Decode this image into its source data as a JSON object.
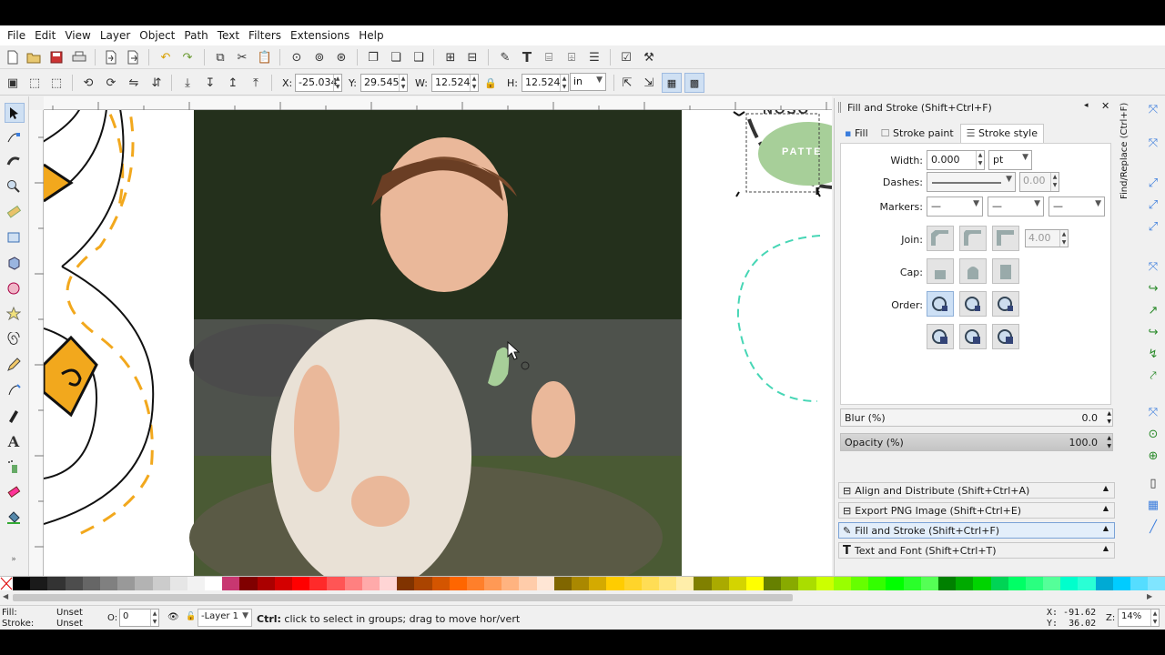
{
  "menubar": {
    "items": [
      "File",
      "Edit",
      "View",
      "Layer",
      "Object",
      "Path",
      "Text",
      "Filters",
      "Extensions",
      "Help"
    ]
  },
  "controls": {
    "x_label": "X:",
    "x_value": "-25.034",
    "y_label": "Y:",
    "y_value": "29.545",
    "w_label": "W:",
    "w_value": "12.524",
    "h_label": "H:",
    "h_value": "12.524",
    "unit": "in"
  },
  "canvas": {
    "pattern_text": "PATTE",
    "top_text": "NOSO"
  },
  "dock": {
    "title": "Fill and Stroke (Shift+Ctrl+F)",
    "tabs": [
      "Fill",
      "Stroke paint",
      "Stroke style"
    ],
    "width_label": "Width:",
    "width_value": "0.000",
    "width_unit": "pt",
    "dashes_label": "Dashes:",
    "dashes_value": "0.00",
    "markers_label": "Markers:",
    "marker_value": "—",
    "join_label": "Join:",
    "miter_value": "4.00",
    "cap_label": "Cap:",
    "order_label": "Order:",
    "blur_label": "Blur (%)",
    "blur_value": "0.0",
    "opacity_label": "Opacity (%)",
    "opacity_value": "100.0",
    "panels": [
      "Align and Distribute (Shift+Ctrl+A)",
      "Export PNG Image (Shift+Ctrl+E)",
      "Fill and Stroke (Shift+Ctrl+F)",
      "Text and Font (Shift+Ctrl+T)"
    ],
    "side_tab": "Find/Replace (Ctrl+F)"
  },
  "status": {
    "fill_label": "Fill:",
    "fill_value": "Unset",
    "stroke_label": "Stroke:",
    "stroke_value": "Unset",
    "o_label": "O:",
    "o_value": "0",
    "layer": "-Layer 1",
    "message_key": "Ctrl:",
    "message": " click to select in groups; drag to move hor/vert",
    "x_coord": "X: -91.62",
    "y_coord": "Y:  36.02",
    "z_label": "Z:",
    "zoom": "14%"
  },
  "colors": {
    "accent": "#3b7ddd",
    "dash_yellow": "#f2a81d",
    "teal": "#46d6b5",
    "pattern_green": "#a7cf99"
  },
  "icons": [
    "new-icon",
    "open-icon",
    "save-icon",
    "print-icon",
    "import-icon",
    "export-icon",
    "undo-icon",
    "redo-icon",
    "copy-icon",
    "cut-icon",
    "paste-icon",
    "zoom-selection-icon",
    "zoom-drawing-icon",
    "zoom-page-icon",
    "duplicate-icon",
    "clone-icon",
    "unlink-icon",
    "group-icon",
    "ungroup-icon",
    "fill-stroke-icon",
    "text-font-icon",
    "xml-editor-icon",
    "align-icon",
    "preferences-icon",
    "document-properties-icon"
  ]
}
